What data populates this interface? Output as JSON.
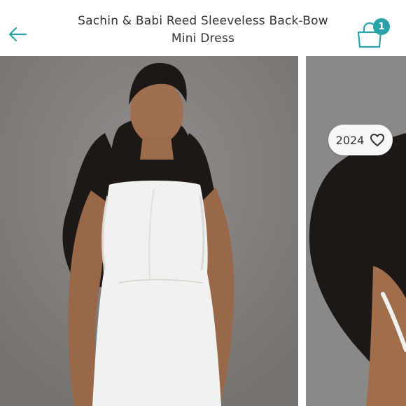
{
  "header": {
    "title_line1": "Sachin & Babi Reed Sleeveless Back-Bow",
    "title_line2": "Mini Dress",
    "cart_count": "1"
  },
  "listing": {
    "like_count": "2024"
  },
  "colors": {
    "accent": "#2aa3a8",
    "photo_background": "#83807f",
    "dress": "#f1f1ef"
  },
  "icons": [
    "back-arrow-icon",
    "shopping-bag-icon",
    "heart-icon"
  ]
}
